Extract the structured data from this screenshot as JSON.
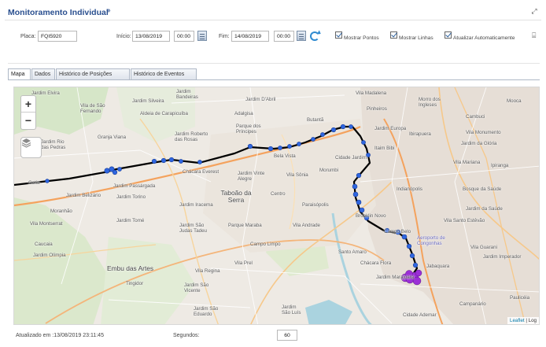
{
  "header": {
    "title": "Monitoramento Individual",
    "title_mark": "✵"
  },
  "filters": {
    "plate_label": "Placa:",
    "plate_value": "FQI5920",
    "start_label": "Início:",
    "start_date": "13/08/2019",
    "start_time": "00:00",
    "end_label": "Fim:",
    "end_date": "14/08/2019",
    "end_time": "00:00",
    "show_points_label": "Mostrar Pontos",
    "show_lines_label": "Mostrar Linhas",
    "auto_update_label": "Atualizar Automaticamente"
  },
  "tabs": [
    {
      "label": "Mapa",
      "active": true
    },
    {
      "label": "Dados",
      "active": false
    },
    {
      "label": "Histórico de Posições",
      "active": false
    },
    {
      "label": "Histórico de Eventos",
      "active": false
    }
  ],
  "map": {
    "zoom_in": "+",
    "zoom_out": "−",
    "attribution_link": "Leaflet",
    "attribution_rest": " | Log",
    "labels": [
      "Vila Madalena",
      "Pinheiros",
      "Morro dos Ingleses",
      "Mooca",
      "Cambuci",
      "Vila Monumento",
      "Jardim da Glória",
      "Vila Mariana",
      "Ipiranga",
      "Bosque da Saúde",
      "Jardim da Saúde",
      "Vila Santo Estêvão",
      "Jardim Europa",
      "Ibirapuera",
      "Indianópolis",
      "Itaim Bibi",
      "Cidade Jardim",
      "Brooklin Novo",
      "Campo Belo",
      "Aeroporto de Congonhas",
      "Vila Guarani",
      "Jabaquara",
      "Jardim Imperador",
      "Paulicéia",
      "Campanário",
      "Cidade Ademar",
      "Santo Amaro",
      "Chácara Flora",
      "Jardim Marajoara",
      "Butantã",
      "Jardim D'Abril",
      "Adalgisa",
      "Parque dos Príncipes",
      "Bela Vista",
      "Jardim Vinte Alegre",
      "Vila Sônia",
      "Morumbi",
      "Paraisópolis",
      "Centro",
      "Vila Andrade",
      "Taboão da Serra",
      "Campo Limpo",
      "Parque Maraba",
      "Jardim Iracema",
      "Chácara Everest",
      "Jardim Roberto das Rosas",
      "Jardim Bandeiras",
      "Aldeia de Carapicuíba",
      "Vila de São Fernando",
      "Jardim Silveira",
      "Jardim Elvira",
      "Jardim Rio das Pedras",
      "Granja Viana",
      "Cotia",
      "Jardim Belizário",
      "Jardim Passárgada",
      "Jardim Torino",
      "Jardim Tomé",
      "Moranhão",
      "Vila Montserrat",
      "Caucaia",
      "Jardim Olímpia",
      "Embu das Artes",
      "Tingidor",
      "Jardim São Judas Tadeu",
      "Vila Regina",
      "Jardim São Vicente",
      "Jardim São Eduardo",
      "Jardim São Luís",
      "Vila Prel"
    ]
  },
  "footer": {
    "updated_label": "Atualizado em :13/08/2019 23:11:45",
    "seconds_label": "Segundos:",
    "seconds_value": "60"
  }
}
